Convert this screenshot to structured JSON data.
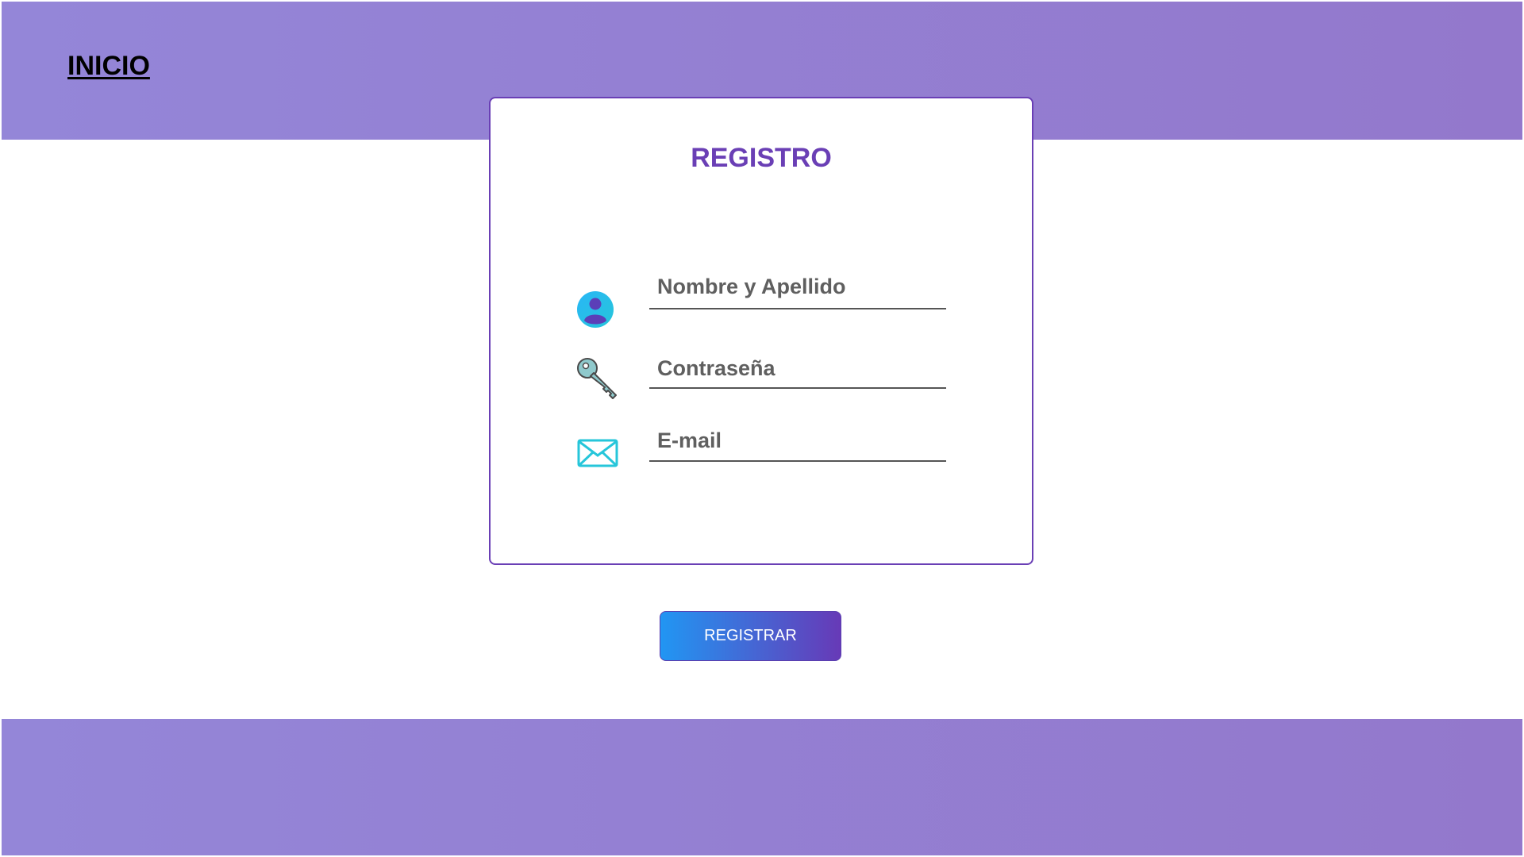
{
  "nav": {
    "home_label": "INICIO"
  },
  "form": {
    "title": "REGISTRO",
    "fields": [
      {
        "placeholder": "Nombre y Apellido",
        "value": "",
        "icon": "user-icon"
      },
      {
        "placeholder": "Contraseña",
        "value": "",
        "icon": "key-icon"
      },
      {
        "placeholder": "E-mail",
        "value": "",
        "icon": "envelope-icon"
      }
    ],
    "submit_label": "REGISTRAR"
  },
  "colors": {
    "band": "#9486d8",
    "accent": "#6a3fb5",
    "button_start": "#2196f3",
    "button_end": "#673ab7"
  }
}
